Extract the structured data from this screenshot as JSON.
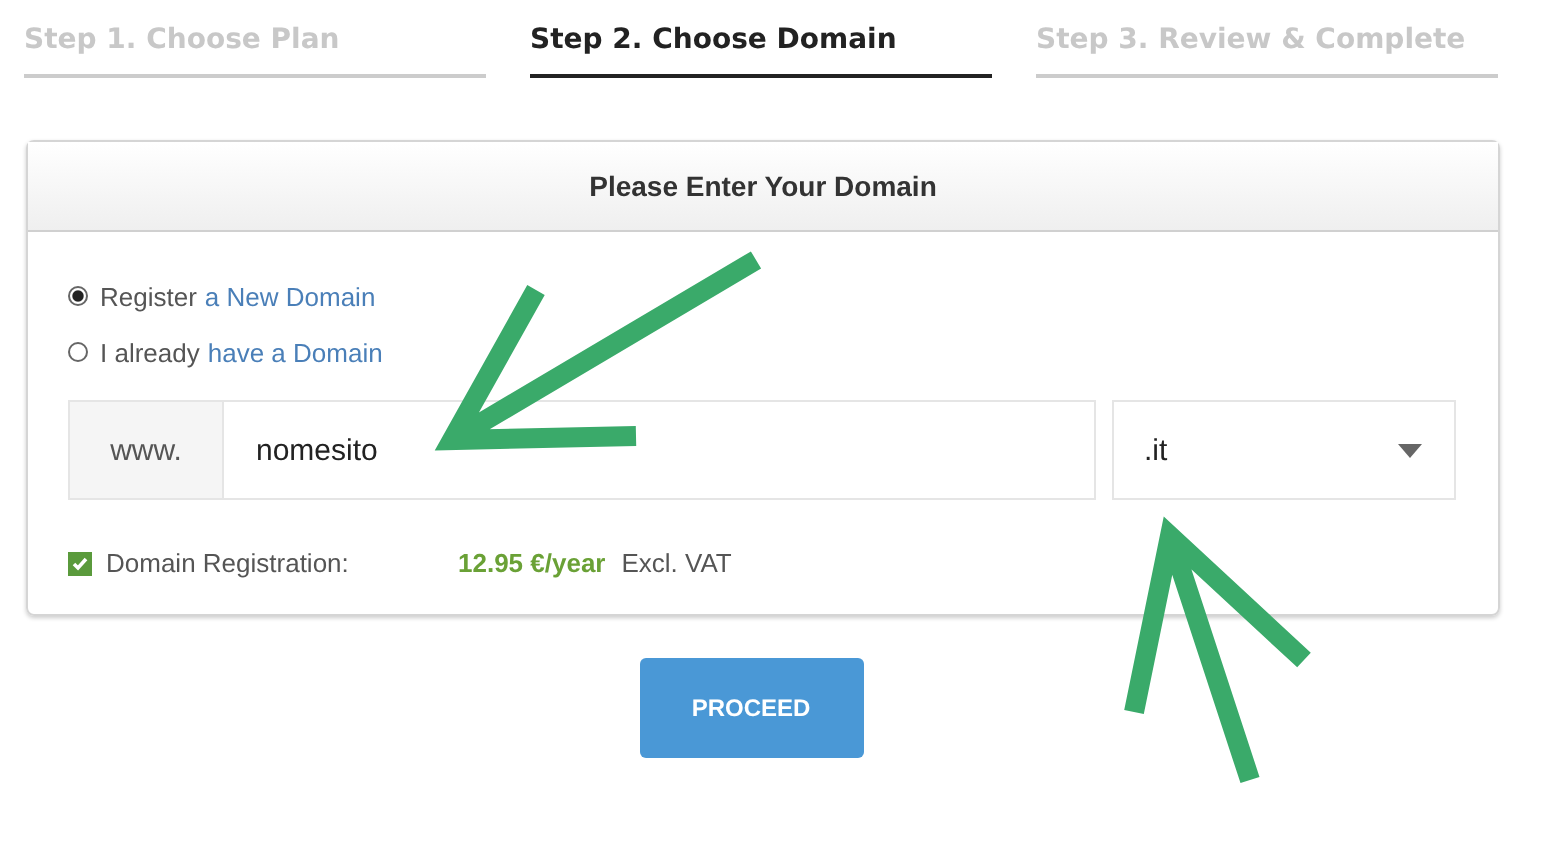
{
  "steps": [
    {
      "label": "Step 1. Choose Plan",
      "selected": false
    },
    {
      "label": "Step 2. Choose Domain",
      "selected": true
    },
    {
      "label": "Step 3. Review & Complete",
      "selected": false
    }
  ],
  "panel": {
    "title": "Please Enter Your Domain",
    "options": [
      {
        "text": "Register",
        "link": "a New Domain",
        "selected": true
      },
      {
        "text": "I already",
        "link": "have a Domain",
        "selected": false
      }
    ],
    "domain": {
      "prefix": "www.",
      "value": "nomesito",
      "tld": ".it"
    },
    "registration": {
      "label": "Domain Registration:",
      "checked": true,
      "price": "12.95 €/year",
      "note": "Excl. VAT"
    }
  },
  "button": "PROCEED"
}
